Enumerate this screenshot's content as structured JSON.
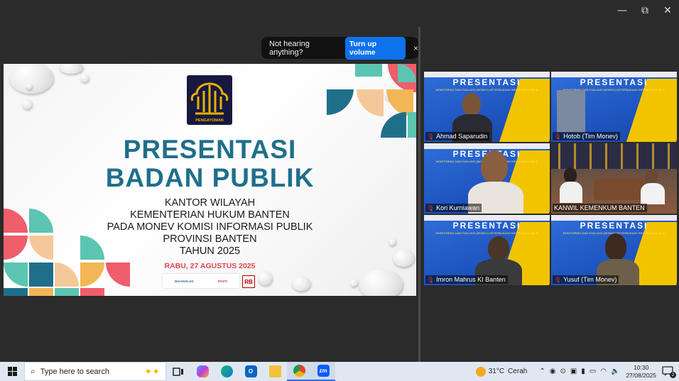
{
  "window_controls": {
    "minimize": "—",
    "restore": "⧉",
    "close": "✕"
  },
  "toast": {
    "message": "Not hearing anything?",
    "button": "Turn up volume",
    "close": "×"
  },
  "slide": {
    "logo_label": "PENGAYOMAN",
    "title_1": "PRESENTASI",
    "title_2": "BADAN PUBLIK",
    "line_1": "KANTOR WILAYAH",
    "line_2": "KEMENTERIAN HUKUM BANTEN",
    "line_3": "PADA MONEV KOMISI INFORMASI PUBLIK",
    "line_4": "PROVINSI BANTEN",
    "line_5": "TAHUN 2025",
    "date": "RABU, 27 AGUSTUS 2025",
    "sponsor_1": "BerAKHLAK",
    "sponsor_2": "PASTI",
    "sponsor_3": "RB"
  },
  "tile_slide_title": "PRESENTASI",
  "tile_slide_sub": "MONITORING DAN EVALUASI (MONEV) KETERBUKAAN INFORMASI PUBLIK",
  "participants": [
    {
      "name": "Ahmad Saparudin"
    },
    {
      "name": "Hotob (Tim Monev)"
    },
    {
      "name": "Kori Kurniawan"
    },
    {
      "name": "KANWIL KEMENKUM BANTEN"
    },
    {
      "name": "Imron Mahrus KI Banten"
    },
    {
      "name": "Yusuf (Tim Monev)"
    }
  ],
  "taskbar": {
    "search_placeholder": "Type here to search",
    "weather_temp": "31°C",
    "weather_text": "Cerah",
    "time": "10:30",
    "date": "27/08/2025",
    "notification_count": "2"
  },
  "colors": {
    "accent": "#0e72ed",
    "slide_title": "#1f6f8b",
    "date": "#e0454a",
    "active_speaker": "#23d96a"
  }
}
